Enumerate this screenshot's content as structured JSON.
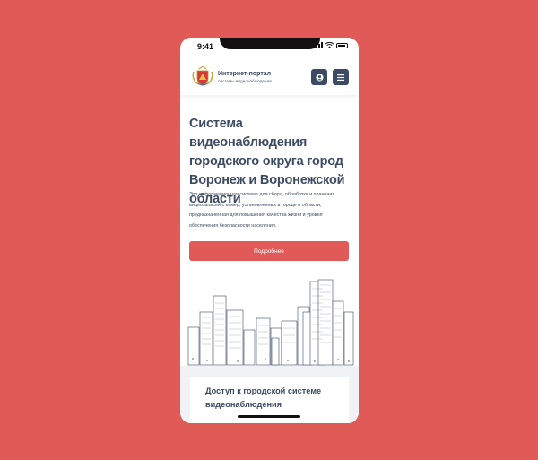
{
  "status_bar": {
    "time": "9:41"
  },
  "header": {
    "title": "Интернет-портал",
    "subtitle": "системы видеонаблюдения",
    "user_icon": "user-circle-icon",
    "menu_icon": "hamburger-menu-icon"
  },
  "hero": {
    "title": "Система видеонаблюдения городского округа город Воронеж и Воронежской области",
    "description": "Это информационная система для сбора, обработки и хранения видеозаписей с камер, установленных в городе и области, предназначенная для повышения качества жизни и уровня обеспечения безопасности населения.",
    "button_label": "Подробнее"
  },
  "section": {
    "title": "Доступ к городской системе видеонаблюдения"
  },
  "colors": {
    "background": "#e05a57",
    "accent": "#e05a57",
    "text": "#3c4a63",
    "header_button": "#3c4a63"
  }
}
